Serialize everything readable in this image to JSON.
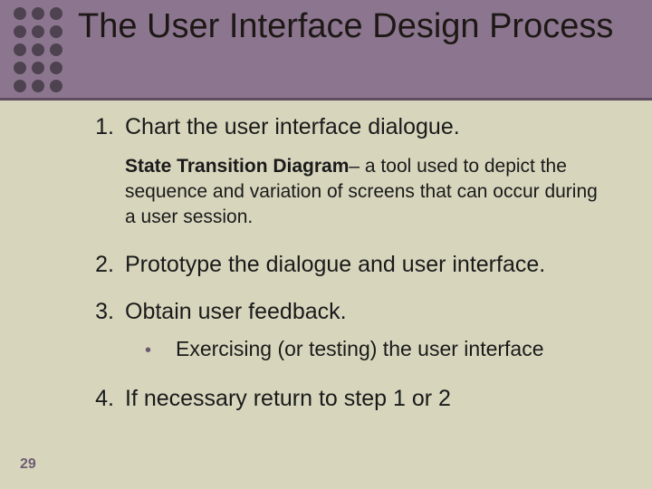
{
  "slide": {
    "title": "The User Interface Design Process",
    "number": "29",
    "items": [
      {
        "num": "1.",
        "text": "Chart the user interface dialogue."
      },
      {
        "num": "2.",
        "text": "Prototype the dialogue and user interface."
      },
      {
        "num": "3.",
        "text": "Obtain user feedback."
      },
      {
        "num": "4.",
        "text": "If necessary return to step 1 or 2"
      }
    ],
    "subnote": {
      "bold": "State Transition Diagram",
      "rest": "– a tool used to depict the sequence and variation of screens that can occur during a user session."
    },
    "bullet": {
      "marker": "•",
      "text": "Exercising (or testing) the user interface"
    }
  }
}
